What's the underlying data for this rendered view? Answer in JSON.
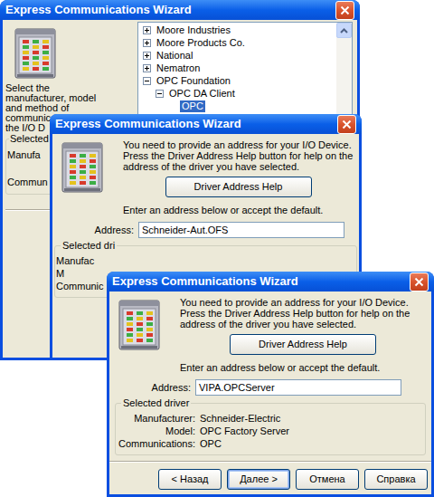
{
  "windows": [
    {
      "title": "Express Communications Wizard",
      "intro": [
        "Select the",
        "manufacturer, model",
        "and method of",
        "communic",
        "the I/O D"
      ],
      "tree": [
        {
          "label": "Moore Industries",
          "kind": "node",
          "expanded": false,
          "selected": false,
          "children": []
        },
        {
          "label": "Moore Products Co.",
          "kind": "node",
          "expanded": false,
          "selected": false,
          "children": []
        },
        {
          "label": "National",
          "kind": "node",
          "expanded": false,
          "selected": false,
          "children": []
        },
        {
          "label": "Nematron",
          "kind": "node",
          "expanded": false,
          "selected": false,
          "children": []
        },
        {
          "label": "OPC Foundation",
          "kind": "node",
          "expanded": true,
          "selected": false,
          "children": [
            {
              "label": "OPC DA Client",
              "kind": "node",
              "expanded": true,
              "selected": false,
              "children": [
                {
                  "label": "OPC",
                  "kind": "leaf",
                  "expanded": false,
                  "selected": true,
                  "children": []
                }
              ]
            }
          ]
        }
      ],
      "group": {
        "legend": "Selected",
        "fields": [
          {
            "label": "Manufa"
          },
          {
            "label": "Commun"
          }
        ]
      }
    },
    {
      "title": "Express Communications Wizard",
      "message": "You need to provide an address for your I/O Device. Press the Driver Address Help button for help on the address of the driver you have selected.",
      "help_button": "Driver Address Help",
      "prompt": "Enter an address below or accept the default.",
      "address": {
        "label": "Address:",
        "value": "Schneider-Aut.OFS"
      },
      "group": {
        "legend": "Selected dri",
        "fields": [
          {
            "label": "Manufac"
          },
          {
            "label": "M"
          },
          {
            "label": "Communic"
          }
        ]
      },
      "buttons": []
    },
    {
      "title": "Express Communications Wizard",
      "message": "You need to provide an address for your I/O Device. Press the Driver Address Help button for help on the address of the driver you have selected.",
      "help_button": "Driver Address Help",
      "prompt": "Enter an address below or accept the default.",
      "address": {
        "label": "Address:",
        "value": "VIPA.OPCServer"
      },
      "group": {
        "legend": "Selected driver",
        "fields": [
          {
            "label": "Manufacturer:",
            "value": "Schneider-Electric"
          },
          {
            "label": "Model:",
            "value": "OPC Factory Server"
          },
          {
            "label": "Communications:",
            "value": "OPC"
          }
        ]
      },
      "buttons": [
        {
          "label": "< Назад",
          "default": false
        },
        {
          "label": "Далее >",
          "default": true
        },
        {
          "label": "Отмена",
          "default": false
        },
        {
          "label": "Справка",
          "default": false
        }
      ]
    }
  ]
}
